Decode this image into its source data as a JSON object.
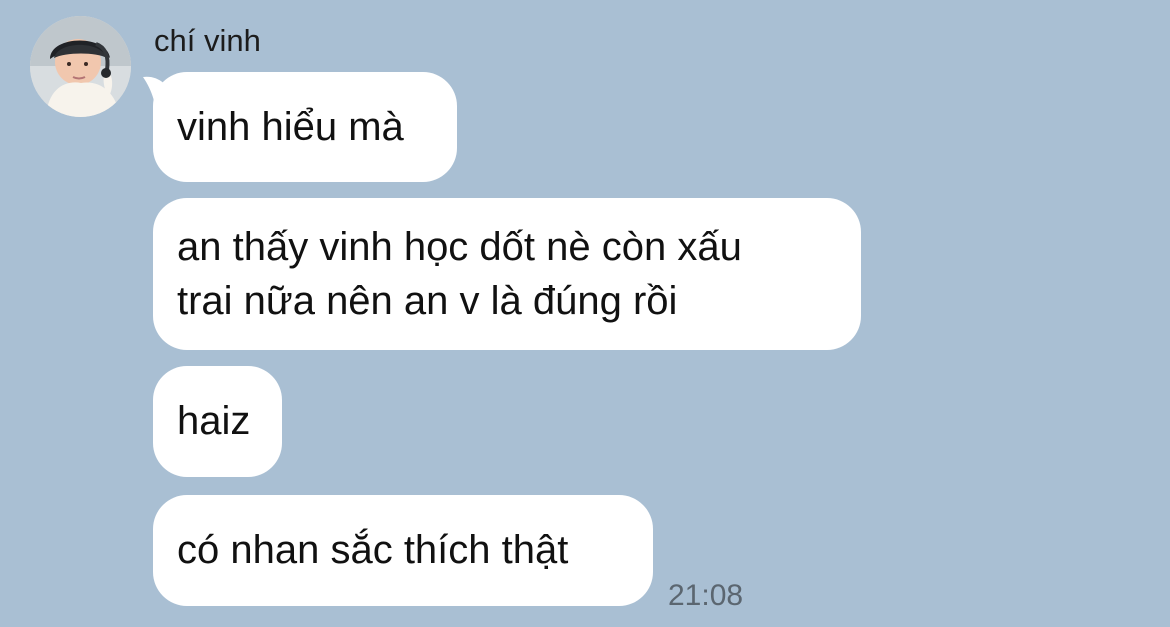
{
  "conversation": {
    "sender_name": "chí vinh",
    "avatar_icon": "profile-photo-icon",
    "messages": [
      {
        "lines": [
          "vinh hiểu mà"
        ]
      },
      {
        "lines": [
          "an thấy vinh học dốt nè còn xấu",
          "trai nữa nên an v là đúng rồi"
        ]
      },
      {
        "lines": [
          "haiz"
        ]
      },
      {
        "lines": [
          "có nhan sắc thích thật"
        ]
      }
    ],
    "timestamp": "21:08"
  },
  "colors": {
    "background": "#a9bfd3",
    "bubble": "#ffffff",
    "text": "#111111",
    "timestamp": "#5b6670"
  }
}
